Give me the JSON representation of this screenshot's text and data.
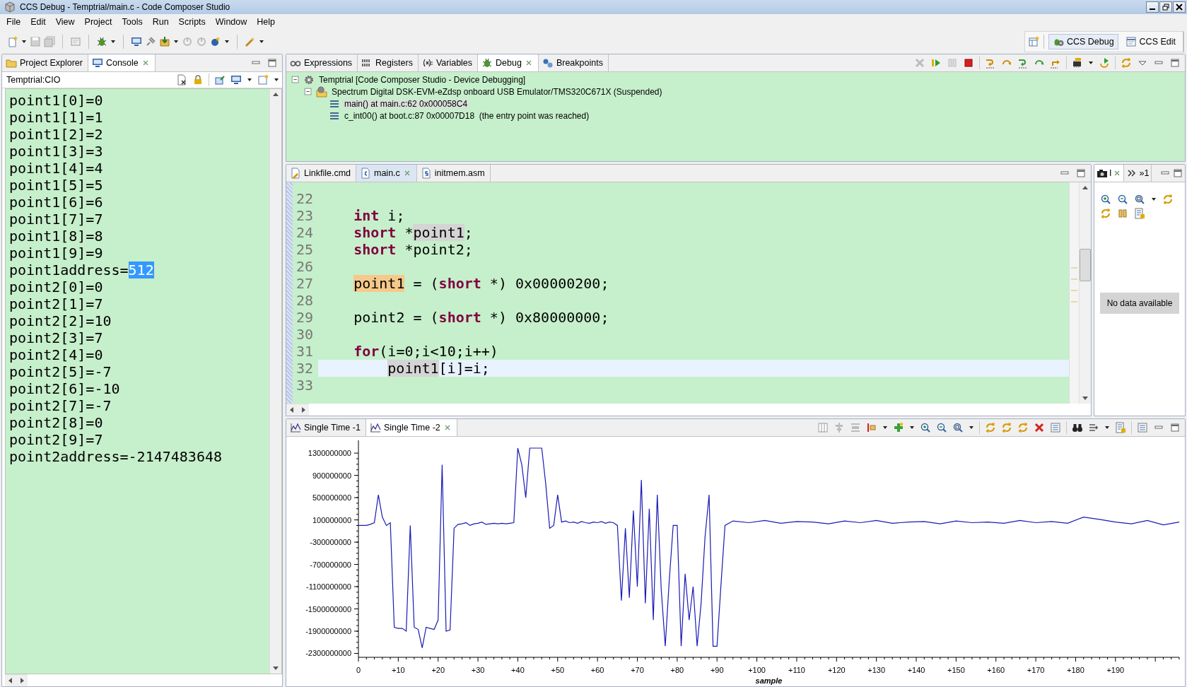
{
  "window": {
    "title": "CCS Debug - Temptrial/main.c - Code Composer Studio"
  },
  "menu": [
    "File",
    "Edit",
    "View",
    "Project",
    "Tools",
    "Run",
    "Scripts",
    "Window",
    "Help"
  ],
  "perspectives": [
    {
      "label": "CCS Debug",
      "selected": true
    },
    {
      "label": "CCS Edit",
      "selected": false
    }
  ],
  "left_view": {
    "tabs": [
      {
        "label": "Project Explorer",
        "selected": false
      },
      {
        "label": "Console",
        "selected": true
      }
    ],
    "console_name": "Temptrial:CIO",
    "lines": [
      "point1[0]=0",
      "point1[1]=1",
      "point1[2]=2",
      "point1[3]=3",
      "point1[4]=4",
      "point1[5]=5",
      "point1[6]=6",
      "point1[7]=7",
      "point1[8]=8",
      "point1[9]=9",
      {
        "text": "point1address=",
        "selection": "512"
      },
      "point2[0]=0",
      "point2[1]=7",
      "point2[2]=10",
      "point2[3]=7",
      "point2[4]=0",
      "point2[5]=-7",
      "point2[6]=-10",
      "point2[7]=-7",
      "point2[8]=0",
      "point2[9]=7",
      "point2address=-2147483648"
    ]
  },
  "debug_view": {
    "tabs": [
      {
        "label": "Expressions",
        "selected": false
      },
      {
        "label": "Registers",
        "selected": false
      },
      {
        "label": "Variables",
        "selected": false
      },
      {
        "label": "Debug",
        "selected": true
      },
      {
        "label": "Breakpoints",
        "selected": false
      }
    ],
    "tree": [
      {
        "label": "Temptrial [Code Composer Studio - Device Debugging]",
        "expanded": true,
        "children": [
          {
            "label": "Spectrum Digital DSK-EVM-eZdsp onboard USB Emulator/TMS320C671X (Suspended)",
            "expanded": true,
            "children": [
              {
                "label": "main() at main.c:62 0x000058C4",
                "selected": true
              },
              {
                "label": "c_int00() at boot.c:87 0x00007D18  (the entry point was reached)",
                "selected": false
              }
            ]
          }
        ]
      }
    ]
  },
  "editor": {
    "tabs": [
      {
        "label": "Linkfile.cmd",
        "selected": false
      },
      {
        "label": "main.c",
        "selected": true
      },
      {
        "label": "initmem.asm",
        "selected": false
      }
    ],
    "lines": [
      {
        "number": "22",
        "current": false
      },
      {
        "number": "23",
        "current": false,
        "segments": [
          {
            "kind": "keyword",
            "text": "    int"
          },
          {
            "kind": "plain",
            "text": " i;"
          }
        ]
      },
      {
        "number": "24",
        "current": false,
        "segments": [
          {
            "kind": "keyword",
            "text": "    short"
          },
          {
            "kind": "plain",
            "text": " *"
          },
          {
            "kind": "occurrence",
            "text": "point1"
          },
          {
            "kind": "plain",
            "text": ";"
          }
        ]
      },
      {
        "number": "25",
        "current": false,
        "segments": [
          {
            "kind": "keyword",
            "text": "    short"
          },
          {
            "kind": "plain",
            "text": " *point2;"
          }
        ]
      },
      {
        "number": "26",
        "current": false
      },
      {
        "number": "27",
        "current": false,
        "segments": [
          {
            "kind": "write_occurrence",
            "text": "    point1"
          },
          {
            "kind": "plain",
            "text": " = ("
          },
          {
            "kind": "keyword",
            "text": "short"
          },
          {
            "kind": "plain",
            "text": " *) 0x00000200;"
          }
        ]
      },
      {
        "number": "28",
        "current": false
      },
      {
        "number": "29",
        "current": false,
        "segments": [
          {
            "kind": "plain",
            "text": "    point2 = ("
          },
          {
            "kind": "keyword",
            "text": "short"
          },
          {
            "kind": "plain",
            "text": " *) 0x80000000;"
          }
        ]
      },
      {
        "number": "30",
        "current": false
      },
      {
        "number": "31",
        "current": false,
        "segments": [
          {
            "kind": "keyword",
            "text": "    for"
          },
          {
            "kind": "plain",
            "text": "(i=0;i<10;i++)"
          }
        ]
      },
      {
        "number": "32",
        "current": true,
        "segments": [
          {
            "kind": "occurrence",
            "text": "        point1"
          },
          {
            "kind": "plain",
            "text": "[i]=i;"
          }
        ]
      },
      {
        "number": "33",
        "current": false
      }
    ]
  },
  "side_view": {
    "tabs": [
      {
        "label": "I",
        "selected": true
      },
      {
        "label": "»1",
        "selected": false
      }
    ],
    "message": "No data available"
  },
  "graph_view": {
    "tabs": [
      {
        "label": "Single Time -1",
        "selected": false
      },
      {
        "label": "Single Time -2",
        "selected": true
      }
    ],
    "chart_data": {
      "type": "line",
      "xlabel": "sample",
      "xlim": [
        0,
        206
      ],
      "ylim": [
        -2370000000,
        1530000000
      ],
      "yticks": [
        1300000000,
        900000000,
        500000000,
        100000000,
        -300000000,
        -700000000,
        -1100000000,
        -1500000000,
        -1900000000,
        -2300000000
      ],
      "xticks": [
        {
          "value": 0,
          "label": "0"
        },
        {
          "value": 10,
          "label": "+10"
        },
        {
          "value": 20,
          "label": "+20"
        },
        {
          "value": 30,
          "label": "+30"
        },
        {
          "value": 40,
          "label": "+40"
        },
        {
          "value": 50,
          "label": "+50"
        },
        {
          "value": 60,
          "label": "+60"
        },
        {
          "value": 70,
          "label": "+70"
        },
        {
          "value": 80,
          "label": "+80"
        },
        {
          "value": 90,
          "label": "+90"
        },
        {
          "value": 100,
          "label": "+100"
        },
        {
          "value": 110,
          "label": "+110"
        },
        {
          "value": 120,
          "label": "+120"
        },
        {
          "value": 130,
          "label": "+130"
        },
        {
          "value": 140,
          "label": "+140"
        },
        {
          "value": 150,
          "label": "+150"
        },
        {
          "value": 160,
          "label": "+160"
        },
        {
          "value": 170,
          "label": "+170"
        },
        {
          "value": 180,
          "label": "+180"
        },
        {
          "value": 190,
          "label": "+190"
        }
      ],
      "x": [
        0,
        1,
        2,
        3,
        4,
        5,
        6,
        7,
        8,
        9,
        10,
        11,
        12,
        13,
        14,
        15,
        16,
        17,
        18,
        19,
        20,
        21,
        22,
        23,
        24,
        25,
        26,
        27,
        28,
        29,
        30,
        31,
        32,
        33,
        34,
        35,
        36,
        37,
        38,
        39,
        40,
        41,
        42,
        43,
        44,
        45,
        46,
        47,
        48,
        49,
        50,
        51,
        52,
        53,
        54,
        55,
        56,
        57,
        58,
        59,
        60,
        61,
        62,
        63,
        64,
        65,
        66,
        67,
        68,
        69,
        70,
        71,
        72,
        73,
        74,
        75,
        76,
        77,
        78,
        79,
        80,
        81,
        82,
        83,
        84,
        85,
        86,
        87,
        88,
        89,
        90,
        91,
        92,
        94,
        98,
        102,
        106,
        110,
        114,
        118,
        122,
        126,
        130,
        134,
        138,
        142,
        146,
        150,
        154,
        158,
        162,
        166,
        170,
        174,
        178,
        182,
        186,
        190,
        194,
        198,
        202,
        206
      ],
      "values": [
        0,
        0,
        0,
        20000000,
        50000000,
        550000000,
        150000000,
        0,
        50000000,
        -1830000000,
        -1850000000,
        -1850000000,
        -1900000000,
        0,
        -1830000000,
        -1870000000,
        -2200000000,
        -1830000000,
        -1850000000,
        -1870000000,
        -1700000000,
        1090000000,
        -1900000000,
        -1880000000,
        -50000000,
        20000000,
        30000000,
        50000000,
        0,
        30000000,
        40000000,
        60000000,
        20000000,
        30000000,
        40000000,
        30000000,
        40000000,
        30000000,
        40000000,
        50000000,
        1390000000,
        1090000000,
        500000000,
        1390000000,
        1390000000,
        1390000000,
        1390000000,
        750000000,
        -50000000,
        0,
        550000000,
        60000000,
        80000000,
        50000000,
        60000000,
        40000000,
        70000000,
        50000000,
        40000000,
        60000000,
        50000000,
        70000000,
        40000000,
        60000000,
        50000000,
        0,
        -1350000000,
        -50000000,
        -1300000000,
        270000000,
        -1100000000,
        820000000,
        -1400000000,
        300000000,
        -1700000000,
        550000000,
        -1150000000,
        -2170000000,
        -1000000000,
        0,
        0,
        -2170000000,
        -870000000,
        -1700000000,
        -1100000000,
        -2170000000,
        -1400000000,
        -200000000,
        550000000,
        -2170000000,
        -2170000000,
        -1050000000,
        0,
        80000000,
        50000000,
        90000000,
        40000000,
        70000000,
        60000000,
        30000000,
        80000000,
        50000000,
        90000000,
        40000000,
        60000000,
        70000000,
        30000000,
        80000000,
        50000000,
        60000000,
        40000000,
        90000000,
        50000000,
        70000000,
        40000000,
        150000000,
        110000000,
        60000000,
        30000000,
        90000000,
        10000000,
        60000000
      ]
    }
  }
}
